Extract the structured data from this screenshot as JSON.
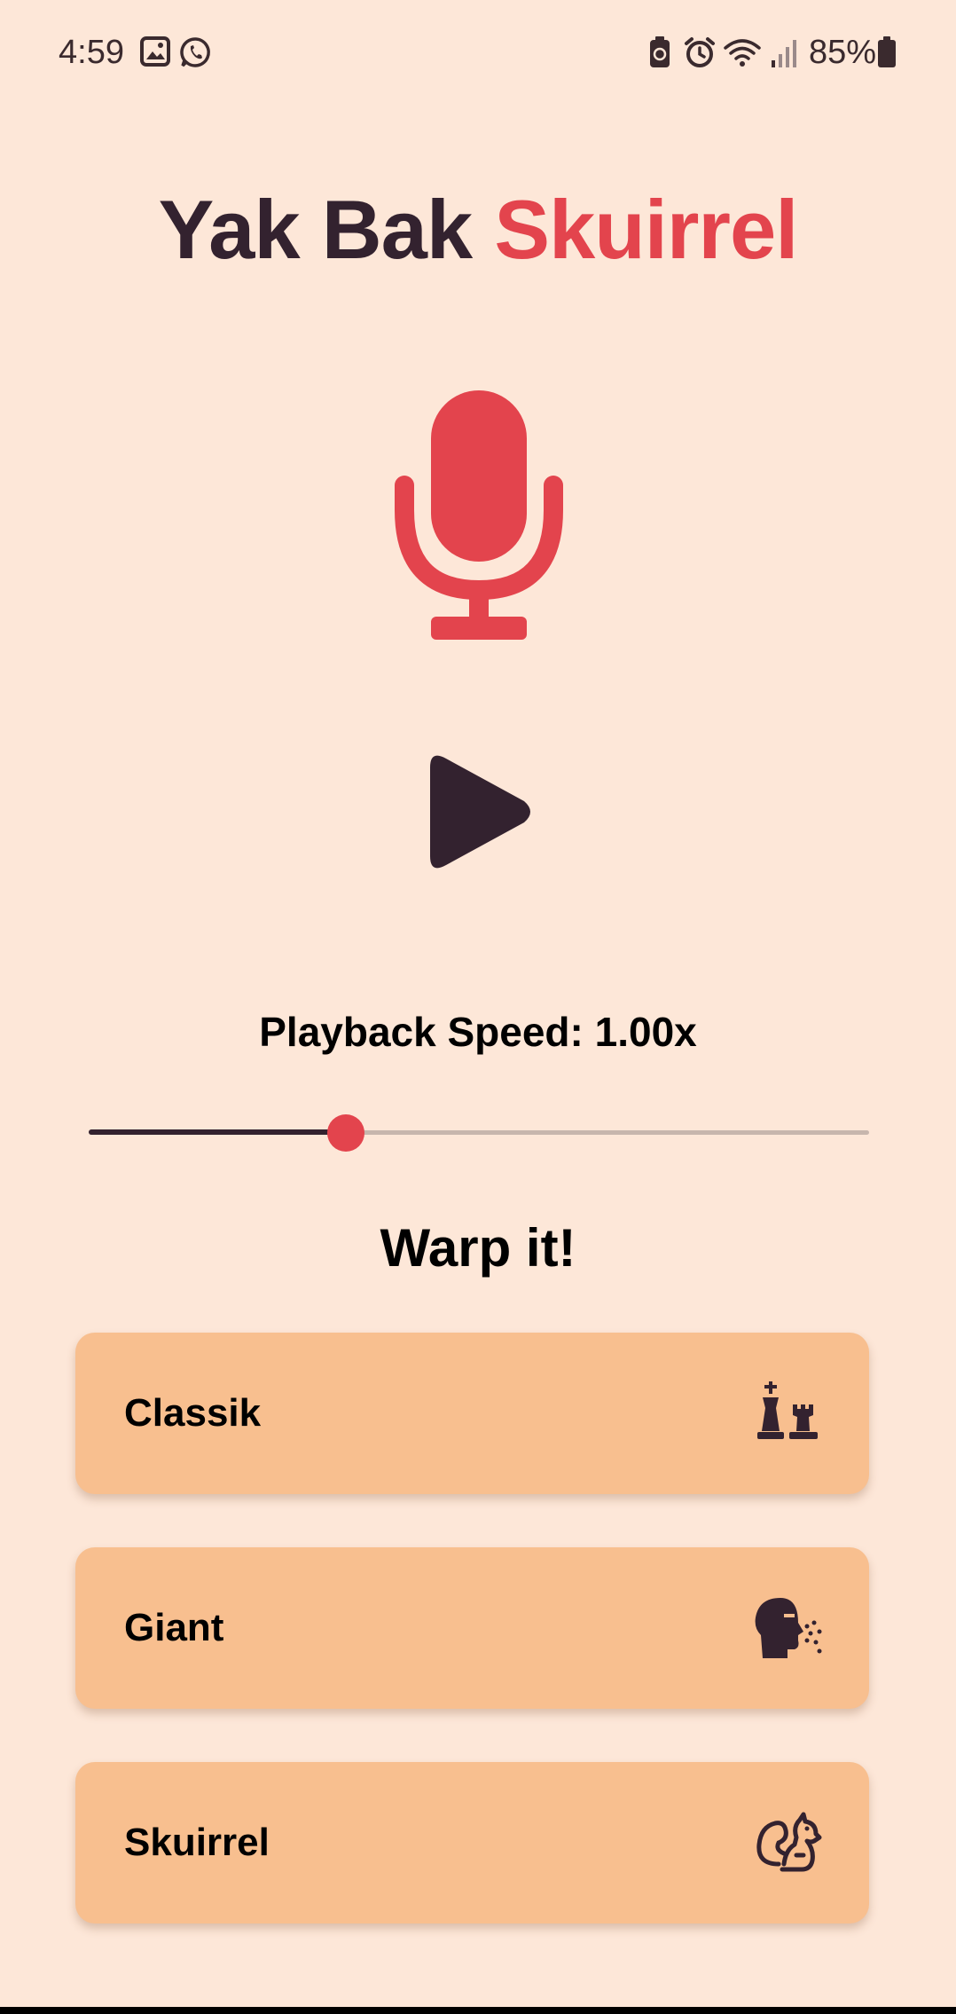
{
  "status_bar": {
    "time": "4:59",
    "battery_percent": "85%",
    "icons": [
      "gallery-icon",
      "whatsapp-icon",
      "battery-saver-icon",
      "alarm-icon",
      "wifi-icon",
      "cell-signal-icon",
      "battery-icon"
    ]
  },
  "app": {
    "title_main": "Yak Bak",
    "title_accent": "Skuirrel",
    "accent_color": "#E3444D",
    "dark_color": "#33222F",
    "background_color": "#FDE7D8",
    "card_color": "#F8BF8F"
  },
  "controls": {
    "record_icon": "microphone-icon",
    "play_icon": "play-icon"
  },
  "playback": {
    "speed_label": "Playback Speed: 1.00x",
    "slider_fraction": 0.33
  },
  "warp": {
    "heading": "Warp it!",
    "effects": [
      {
        "label": "Classik",
        "icon": "chess-pieces-icon"
      },
      {
        "label": "Giant",
        "icon": "head-speaking-icon"
      },
      {
        "label": "Skuirrel",
        "icon": "squirrel-icon"
      }
    ]
  }
}
